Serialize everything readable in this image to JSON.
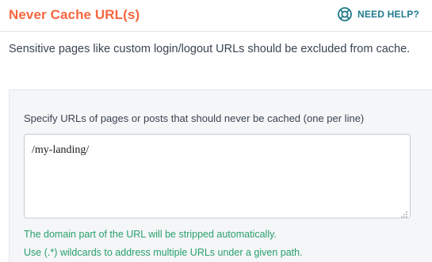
{
  "section": {
    "title": "Never Cache URL(s)",
    "help_label": "NEED HELP?",
    "description": "Sensitive pages like custom login/logout URLs should be excluded from cache."
  },
  "field": {
    "label": "Specify URLs of pages or posts that should never be cached (one per line)",
    "value": "/my-landing/",
    "notes": [
      "The domain part of the URL will be stripped automatically.",
      "Use (.*) wildcards to address multiple URLs under a given path."
    ]
  },
  "colors": {
    "title": "#f56640",
    "help": "#1f7a8c",
    "note": "#27a06c"
  },
  "icons": {
    "help": "lifebuoy-icon",
    "resize": "resize-grip-icon"
  }
}
